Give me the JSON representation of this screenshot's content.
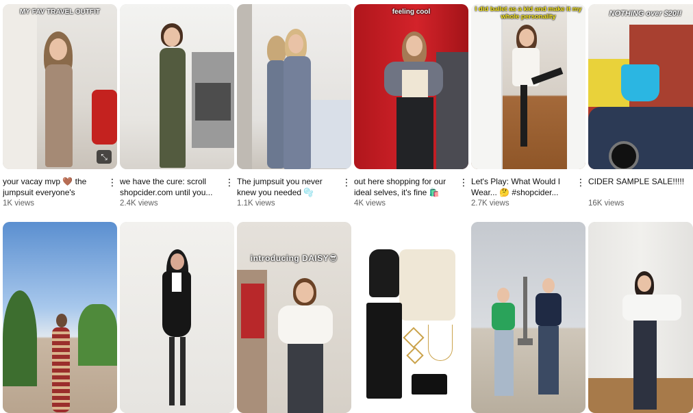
{
  "videos": [
    {
      "overlay": "MY FAV TRAVEL OUTFIT",
      "title": "your vacay mvp 🤎 the jumpsuit everyone's raving...",
      "views": "1K views",
      "badge": "⤡"
    },
    {
      "overlay": "",
      "title": "we have the cure: scroll shopcider.com until you...",
      "views": "2.4K views"
    },
    {
      "overlay": "",
      "title": "The jumpsuit you never knew you needed 🫧 #shopcider...",
      "views": "1.1K views"
    },
    {
      "overlay": "feeling cool",
      "title": "out here shopping for our ideal selves, it's fine 🛍️💅...",
      "views": "4K views"
    },
    {
      "overlay": "I did ballet as a kid and make it my whole personality",
      "title": "Let's Play: What Would I Wear... 🤔 #shopcider...",
      "views": "2.7K views"
    },
    {
      "overlay": "NOTHING over $20!!",
      "title": "CIDER SAMPLE SALE!!!!!",
      "views": "16K views"
    },
    {
      "overlay": "",
      "title": "",
      "views": ""
    },
    {
      "overlay": "",
      "title": "",
      "views": ""
    },
    {
      "overlay": "introducing DAISY😎",
      "title": "",
      "views": ""
    },
    {
      "overlay": "",
      "title": "",
      "views": ""
    },
    {
      "overlay": "",
      "title": "",
      "views": ""
    },
    {
      "overlay": "",
      "title": "",
      "views": ""
    }
  ],
  "more_icon": "⋮",
  "colors": {
    "title": "#0f0f0f",
    "views": "#606060"
  }
}
